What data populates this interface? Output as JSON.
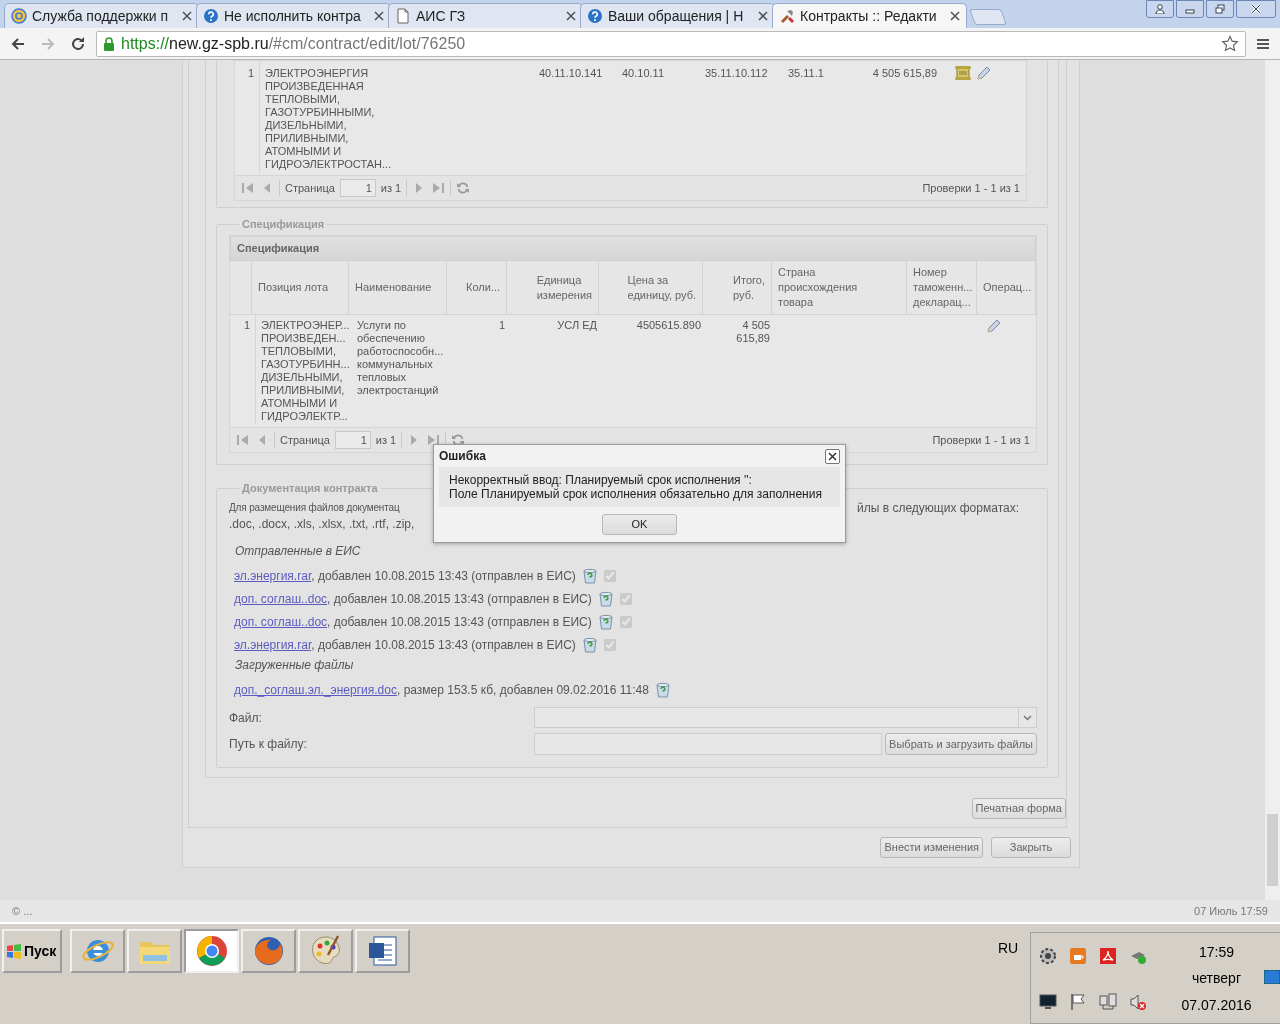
{
  "browser": {
    "tabs": [
      {
        "title": "Служба поддержки п",
        "selected": false
      },
      {
        "title": "Не исполнить контра",
        "selected": false
      },
      {
        "title": "АИС ГЗ",
        "selected": false
      },
      {
        "title": "Ваши обращения | Н",
        "selected": false
      },
      {
        "title": "Контракты :: Редакти",
        "selected": true
      }
    ],
    "forward_disabled": true,
    "url": {
      "scheme": "https://",
      "host": "new.gz-spb.ru",
      "path": "/#cm/contract/edit/lot/76250"
    }
  },
  "lots_grid": {
    "rows": [
      {
        "number": "1",
        "name": "ЭЛЕКТРОЭНЕРГИЯ\nПРОИЗВЕДЕННАЯ\nТЕПЛОВЫМИ,\nГАЗОТУРБИННЫМИ,\nДИЗЕЛЬНЫМИ,\nПРИЛИВНЫМИ,\nАТОМНЫМИ И\nГИДРОЭЛЕКТРОСТАН...",
        "column_3": "40.11.10.141",
        "column_4": "40.10.11",
        "column_5": "35.11.10.112",
        "column_6": "35.11.1",
        "column_7": "4 505 615,89"
      }
    ],
    "pager": {
      "page_label": "Страница",
      "page": "1",
      "of": "из 1",
      "summary": "Проверки 1 - 1 из 1"
    }
  },
  "specification": {
    "legend": "Спецификация",
    "title": "Спецификация",
    "columns": [
      "Позиция лота",
      "Наименование",
      "Коли...",
      "Единица\nизмерения",
      "Цена за\nединицу, руб.",
      "Итого,\nруб.",
      "Страна\nпроисхождения\nтовара",
      "Номер\nтаможенн...\nдекларац...",
      "Операц..."
    ],
    "rows": [
      {
        "number": "1",
        "position": "ЭЛЕКТРОЭНЕР...\nПРОИЗВЕДЕН...\nТЕПЛОВЫМИ,\nГАЗОТУРБИНН...\nДИЗЕЛЬНЫМИ,\nПРИЛИВНЫМИ,\nАТОМНЫМИ И\nГИДРОЭЛЕКТР...",
        "name": "Услуги по\nобеспечению\nработоспособн...\nкоммунальных\nтепловых\nэлектростанций",
        "quantity": "1",
        "unit": "УСЛ ЕД",
        "price": "4505615.890",
        "total": "4 505\n615,89"
      }
    ],
    "pager": {
      "page_label": "Страница",
      "page": "1",
      "of": "из 1",
      "summary": "Проверки 1 - 1 из 1"
    }
  },
  "documents": {
    "legend": "Документация контракта",
    "description_left": "Для размещения файлов документац",
    "description_right": "йлы в следующих форматах:",
    "formats": ".doc, .docx, .xls, .xlsx, .txt, .rtf, .zip,",
    "sent_heading": "Отправленные в ЕИС",
    "sent_files": [
      {
        "link": "эл.энергия.rar",
        "details": ", добавлен 10.08.2015 13:43 (отправлен в ЕИС)",
        "checked": true
      },
      {
        "link": "доп. соглаш..doc",
        "details": ", добавлен 10.08.2015 13:43 (отправлен в ЕИС)",
        "checked": true
      },
      {
        "link": "доп. соглаш..doc",
        "details": ", добавлен 10.08.2015 13:43 (отправлен в ЕИС)",
        "checked": true
      },
      {
        "link": "эл.энергия.rar",
        "details": ", добавлен 10.08.2015 13:43 (отправлен в ЕИС)",
        "checked": true
      }
    ],
    "uploaded_heading": "Загруженные файлы",
    "uploaded_files": [
      {
        "link": "доп._соглаш.эл._энергия.doc",
        "details": ", размер 153.5 кб, добавлен 09.02.2016 11:48"
      }
    ],
    "file_label": "Файл:",
    "path_label": "Путь к файлу:",
    "upload_button": "Выбрать и загрузить файлы"
  },
  "print_button": "Печатная форма",
  "actions": [
    "Внести изменения",
    "Закрыть"
  ],
  "dialog": {
    "title": "Ошибка",
    "message": "Некорректный ввод: Планируемый срок исполнения '':\nПоле Планируемый срок исполнения обязательно для заполнения",
    "button": "OK"
  },
  "status_bar": {
    "left": "© ...",
    "right": "07 Июль 17:59"
  },
  "taskbar": {
    "start": "Пуск",
    "apps": [
      {
        "selected": false
      },
      {
        "selected": false
      },
      {
        "selected": true
      },
      {
        "selected": false
      },
      {
        "selected": false
      },
      {
        "selected": false
      }
    ],
    "language": "RU",
    "clock": {
      "time": "17:59",
      "day": "четверг",
      "date": "07.07.2016"
    }
  }
}
